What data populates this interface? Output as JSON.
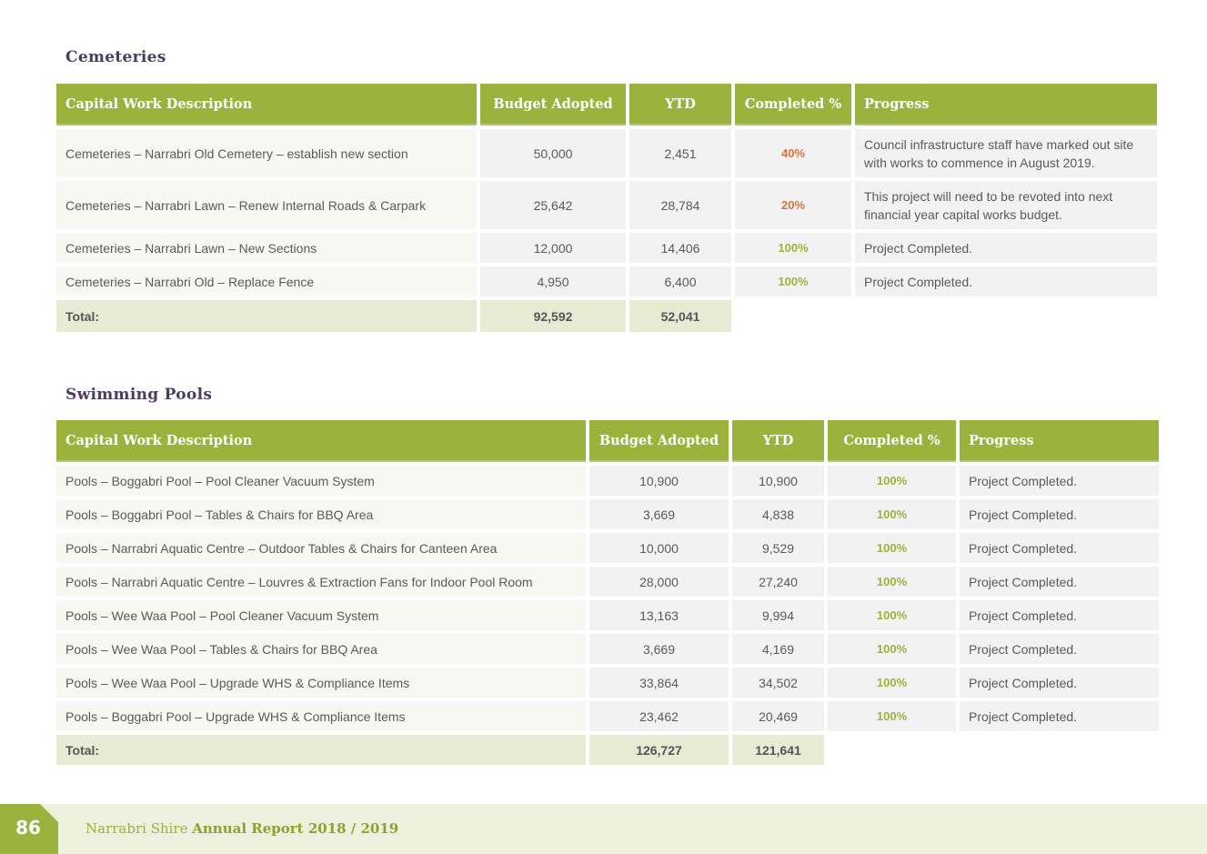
{
  "cemeteries": {
    "title": "Cemeteries",
    "headers": [
      "Capital Work Description",
      "Budget Adopted",
      "YTD",
      "Completed %",
      "Progress"
    ],
    "rows": [
      {
        "desc": "Cemeteries – Narrabri Old Cemetery – establish new section",
        "budget": "50,000",
        "ytd": "2,451",
        "pct": "40%",
        "progress": "Council infrastructure staff have marked out site with works to commence in August 2019."
      },
      {
        "desc": "Cemeteries – Narrabri Lawn – Renew Internal Roads & Carpark",
        "budget": "25,642",
        "ytd": "28,784",
        "pct": "20%",
        "progress": "This project will need to be revoted into next financial year capital works budget."
      },
      {
        "desc": "Cemeteries – Narrabri Lawn – New Sections",
        "budget": "12,000",
        "ytd": "14,406",
        "pct": "100%",
        "progress": "Project Completed."
      },
      {
        "desc": "Cemeteries – Narrabri Old – Replace Fence",
        "budget": "4,950",
        "ytd": "6,400",
        "pct": "100%",
        "progress": "Project Completed."
      }
    ],
    "total": {
      "label": "Total:",
      "budget": "92,592",
      "ytd": "52,041"
    }
  },
  "pools": {
    "title": "Swimming Pools",
    "headers": [
      "Capital Work Description",
      "Budget Adopted",
      "YTD",
      "Completed %",
      "Progress"
    ],
    "rows": [
      {
        "desc": "Pools – Boggabri Pool – Pool Cleaner Vacuum System",
        "budget": "10,900",
        "ytd": "10,900",
        "pct": "100%",
        "progress": "Project Completed."
      },
      {
        "desc": "Pools – Boggabri Pool – Tables & Chairs for BBQ Area",
        "budget": "3,669",
        "ytd": "4,838",
        "pct": "100%",
        "progress": "Project Completed."
      },
      {
        "desc": "Pools – Narrabri Aquatic Centre – Outdoor Tables & Chairs for Canteen Area",
        "budget": "10,000",
        "ytd": "9,529",
        "pct": "100%",
        "progress": "Project Completed."
      },
      {
        "desc": "Pools – Narrabri Aquatic Centre – Louvres & Extraction Fans for Indoor Pool Room",
        "budget": "28,000",
        "ytd": "27,240",
        "pct": "100%",
        "progress": "Project Completed."
      },
      {
        "desc": "Pools – Wee Waa Pool – Pool Cleaner Vacuum System",
        "budget": "13,163",
        "ytd": "9,994",
        "pct": "100%",
        "progress": "Project Completed."
      },
      {
        "desc": "Pools – Wee Waa Pool – Tables & Chairs for BBQ Area",
        "budget": "3,669",
        "ytd": "4,169",
        "pct": "100%",
        "progress": "Project Completed."
      },
      {
        "desc": "Pools – Wee Waa Pool – Upgrade WHS & Compliance Items",
        "budget": "33,864",
        "ytd": "34,502",
        "pct": "100%",
        "progress": "Project Completed."
      },
      {
        "desc": "Pools – Boggabri Pool – Upgrade WHS & Compliance Items",
        "budget": "23,462",
        "ytd": "20,469",
        "pct": "100%",
        "progress": "Project Completed."
      }
    ],
    "total": {
      "label": "Total:",
      "budget": "126,727",
      "ytd": "121,641"
    }
  },
  "footer": {
    "page_number": "86",
    "org": "Narrabri Shire",
    "report": "Annual Report 2018 / 2019"
  },
  "colors": {
    "accent": "#9bb33c",
    "title": "#4a3d63",
    "partial": "#e0703b"
  }
}
